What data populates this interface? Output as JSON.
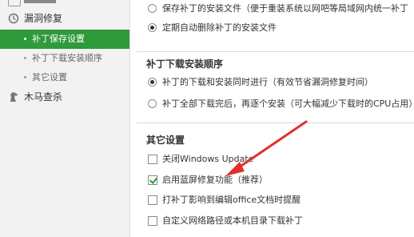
{
  "sidebar": {
    "groups": [
      {
        "label": "漏洞修复",
        "icon": "refresh-icon"
      },
      {
        "label": "木马查杀",
        "icon": "horse-icon"
      }
    ],
    "items": [
      {
        "label": "补丁保存设置",
        "active": true
      },
      {
        "label": "补丁下载安装顺序",
        "active": false
      },
      {
        "label": "其它设置",
        "active": false
      }
    ]
  },
  "save_section": {
    "options": [
      {
        "label": "保存补丁的安装文件（便于重装系统以网吧等局域网内统一补丁",
        "selected": false
      },
      {
        "label": "定期自动删除补丁的安装文件",
        "selected": true
      }
    ]
  },
  "download_section": {
    "title": "补丁下载安装顺序",
    "options": [
      {
        "label": "补丁的下载和安装同时进行（有效节省漏洞修复时间）",
        "selected": true
      },
      {
        "label": "补丁全部下载完后，再逐个安装（可大幅减少下载时的CPU占用）",
        "selected": false
      }
    ]
  },
  "other_section": {
    "title": "其它设置",
    "options": [
      {
        "label": "关闭Windows Update",
        "checked": false
      },
      {
        "label": "启用蓝屏修复功能（推荐）",
        "checked": true
      },
      {
        "label": "打补丁影响到编辑office文档时提醒",
        "checked": false
      },
      {
        "label": "自定义网络路径或本机目录下载补丁",
        "checked": false
      }
    ]
  },
  "colors": {
    "accent": "#2e9a3c",
    "arrow": "#e0302c"
  }
}
